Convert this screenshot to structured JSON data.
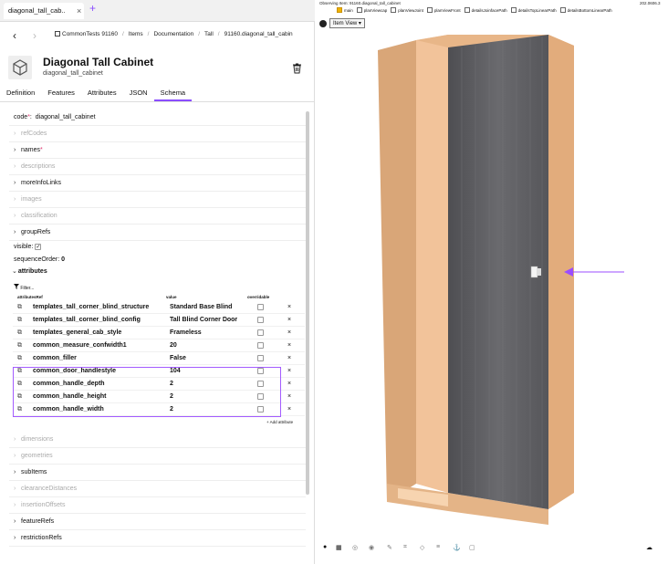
{
  "browser": {
    "tab_title": "diagonal_tall_cab..",
    "tab_close": "×",
    "tab_add": "+"
  },
  "nav": {
    "back": "‹",
    "forward": "›",
    "breadcrumb": [
      "CommonTests 91160",
      "Items",
      "Documentation",
      "Tall",
      "91160.diagonal_tall_cabin"
    ],
    "separator": "/"
  },
  "item": {
    "title": "Diagonal Tall Cabinet",
    "subtitle": "diagonal_tall_cabinet"
  },
  "tabs": [
    "Definition",
    "Features",
    "Attributes",
    "JSON",
    "Schema"
  ],
  "schema": {
    "code_label": "code",
    "code_value": "diagonal_tall_cabinet",
    "required_mark": "*",
    "rows": [
      {
        "label": "refCodes"
      },
      {
        "label": "names"
      },
      {
        "label": "descriptions"
      },
      {
        "label": "moreInfoLinks"
      },
      {
        "label": "images"
      },
      {
        "label": "classification"
      },
      {
        "label": "groupRefs"
      }
    ],
    "visible_label": "visible:",
    "sequence_label": "sequenceOrder:",
    "sequence_value": "0",
    "attributes_label": "attributes",
    "filter_placeholder": "Filter...",
    "table_headers": {
      "ref": "attributesRef",
      "value": "value",
      "overridable": "overridable"
    },
    "attributes": [
      {
        "name": "templates_tall_corner_blind_structure",
        "value": "Standard Base Blind"
      },
      {
        "name": "templates_tall_corner_blind_config",
        "value": "Tall Blind Corner Door"
      },
      {
        "name": "templates_general_cab_style",
        "value": "Frameless"
      },
      {
        "name": "common_measure_confwidth1",
        "value": "20"
      },
      {
        "name": "common_filler",
        "value": "False"
      },
      {
        "name": "common_door_handlestyle",
        "value": "104"
      },
      {
        "name": "common_handle_depth",
        "value": "2"
      },
      {
        "name": "common_handle_height",
        "value": "2"
      },
      {
        "name": "common_handle_width",
        "value": "2"
      }
    ],
    "delete_glyph": "×",
    "ext_glyph": "⧉",
    "add_attribute": "+ Add attribute",
    "lower_rows": [
      {
        "label": "dimensions"
      },
      {
        "label": "geometries"
      },
      {
        "label": "subItems"
      },
      {
        "label": "clearanceDistances"
      },
      {
        "label": "insertionOffsets"
      },
      {
        "label": "featureRefs"
      },
      {
        "label": "restrictionRefs"
      }
    ]
  },
  "viewer": {
    "status": "Observing Item: 91160.diagonal_tall_cabinet",
    "version": "202.0606.3",
    "checkboxes": [
      {
        "label": "main",
        "checked": true
      },
      {
        "label": "planViewcap",
        "checked": false
      },
      {
        "label": "planViewJoint",
        "checked": false
      },
      {
        "label": "planViewFront",
        "checked": false
      },
      {
        "label": "detailsJoinfacePath",
        "checked": false
      },
      {
        "label": "detailsTopLinearPath",
        "checked": false
      },
      {
        "label": "detailsBottomLinearPath",
        "checked": false
      }
    ],
    "view_select": "Item View",
    "colors": {
      "wood": "#f2c39a",
      "wood_side": "#d9a678",
      "door": "#5c5c5f",
      "arrow": "#9b4dff",
      "highlight": "#a35cff"
    },
    "bottom_icons": [
      "palette-icon",
      "grid-icon",
      "compass-icon",
      "eye-icon",
      "pen-icon",
      "crop-icon",
      "diamond-icon",
      "layers-icon",
      "anchor-icon",
      "frame-icon",
      "cloud-icon"
    ]
  }
}
